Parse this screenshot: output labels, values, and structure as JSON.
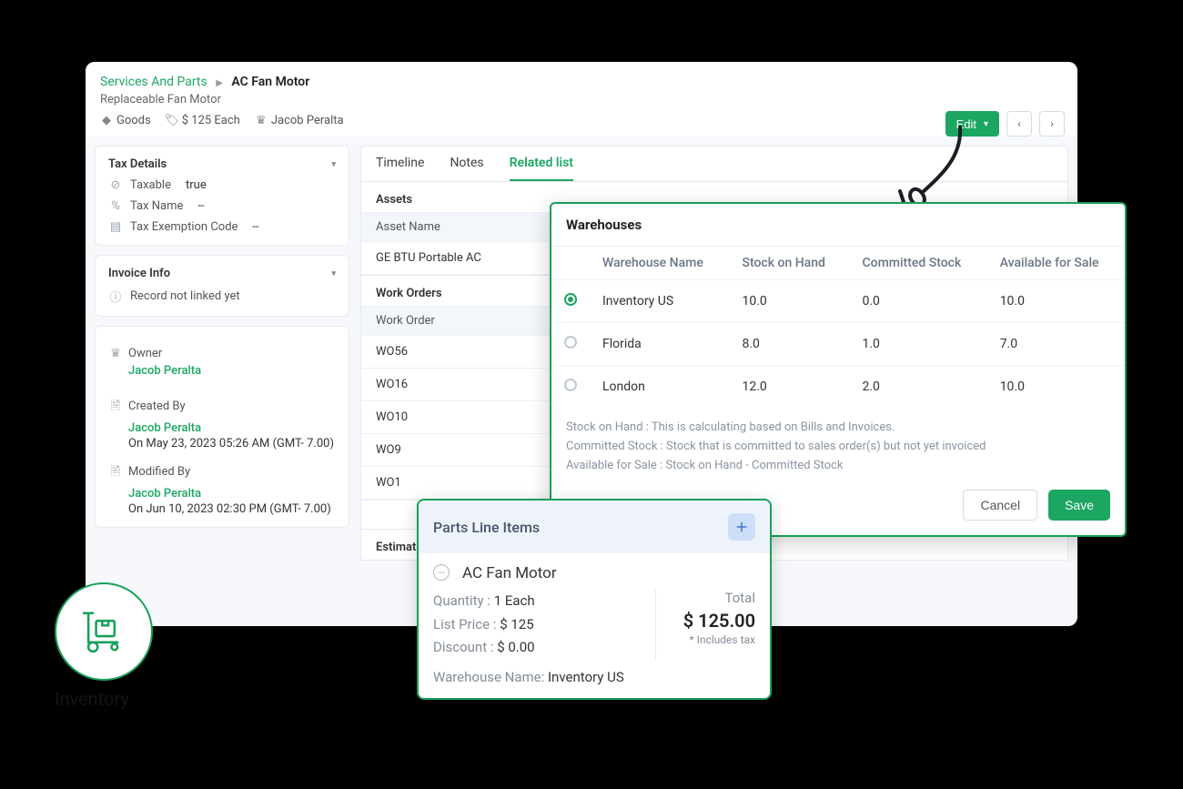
{
  "breadcrumb": {
    "parent": "Services And Parts",
    "current": "AC Fan Motor"
  },
  "subtitle": "Replaceable Fan Motor",
  "meta": {
    "goods": "Goods",
    "price": "$ 125 Each",
    "owner": "Jacob Peralta"
  },
  "edit_label": "Edit",
  "sidebar": {
    "tax": {
      "title": "Tax Details",
      "rows": [
        {
          "label": "Taxable",
          "value": "true"
        },
        {
          "label": "Tax Name",
          "value": "--"
        },
        {
          "label": "Tax Exemption Code",
          "value": "--"
        }
      ]
    },
    "invoice": {
      "title": "Invoice Info",
      "not_linked": "Record not linked yet"
    },
    "owner_block": {
      "owner_label": "Owner",
      "owner_value": "Jacob Peralta",
      "created_label": "Created By",
      "created_by": "Jacob Peralta",
      "created_ts": "On May 23, 2023 05:26 AM (GMT- 7.00)",
      "modified_label": "Modified By",
      "modified_by": "Jacob Peralta",
      "modified_ts": "On Jun 10, 2023 02:30 PM (GMT- 7.00)"
    }
  },
  "tabs": [
    "Timeline",
    "Notes",
    "Related list"
  ],
  "active_tab_index": 2,
  "assets": {
    "title": "Assets",
    "col": "Asset Name",
    "rows": [
      "GE BTU Portable AC"
    ]
  },
  "work_orders": {
    "title": "Work Orders",
    "col": "Work Order",
    "rows": [
      "WO56",
      "WO16",
      "WO10",
      "WO9",
      "WO1"
    ]
  },
  "estimates_title": "Estimate",
  "totals": {
    "qty": "1",
    "amount": "$ 125"
  },
  "warehouse_modal": {
    "title": "Warehouses",
    "headers": [
      "Warehouse Name",
      "Stock on Hand",
      "Committed Stock",
      "Available for Sale"
    ],
    "rows": [
      {
        "name": "Inventory US",
        "on_hand": "10.0",
        "committed": "0.0",
        "available": "10.0",
        "selected": true
      },
      {
        "name": "Florida",
        "on_hand": "8.0",
        "committed": "1.0",
        "available": "7.0",
        "selected": false
      },
      {
        "name": "London",
        "on_hand": "12.0",
        "committed": "2.0",
        "available": "10.0",
        "selected": false
      }
    ],
    "notes": [
      "Stock on Hand : This is calculating based on Bills and Invoices.",
      "Committed Stock : Stock that is committed to sales order(s) but not yet invoiced",
      "Available for Sale : Stock on Hand - Committed Stock"
    ],
    "cancel": "Cancel",
    "save": "Save"
  },
  "parts": {
    "title": "Parts Line Items",
    "item_name": "AC Fan Motor",
    "qty_label": "Quantity :",
    "qty_value": "1 Each",
    "list_label": "List Price :",
    "list_value": "$ 125",
    "disc_label": "Discount :",
    "disc_value": "$ 0.00",
    "total_label": "Total",
    "total_value": "$ 125.00",
    "tax_note": "* Includes tax",
    "wh_label": "Warehouse Name:",
    "wh_value": "Inventory US"
  }
}
